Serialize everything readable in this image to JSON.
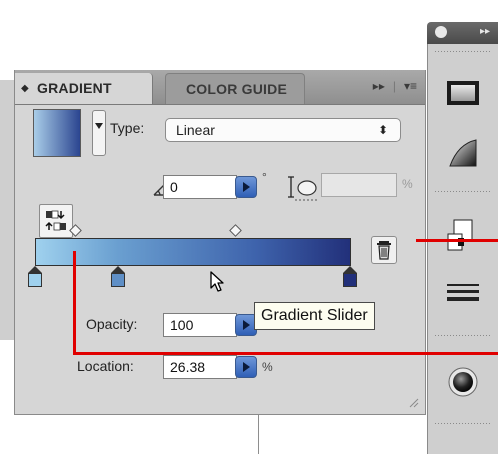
{
  "panel": {
    "tabs": [
      {
        "label": "GRADIENT",
        "active": true,
        "arrows": "◆"
      },
      {
        "label": "COLOR GUIDE",
        "active": false
      }
    ],
    "controls": {
      "expand": "▸▸",
      "menu": "▾≡"
    }
  },
  "type": {
    "label": "Type:",
    "value": "Linear"
  },
  "angle": {
    "value": "0",
    "unit": "°"
  },
  "aspect": {
    "value": "",
    "unit": "%"
  },
  "opacity": {
    "label": "Opacity:",
    "value": "100"
  },
  "location": {
    "label": "Location:",
    "value": "26.38",
    "unit": "%"
  },
  "tooltip": {
    "text": "Gradient Slider"
  },
  "icons": {
    "reverse": "reverse-gradient-icon",
    "angle": "angle-icon",
    "aspect": "aspect-ratio-icon",
    "delete": "trash-icon",
    "cursor": "arrow-cursor-icon"
  },
  "colors": {
    "gradient_start": "#9fd1ee",
    "gradient_end": "#22307a",
    "annotation": "#e00000",
    "tooltip_bg": "#fdfdf0"
  }
}
